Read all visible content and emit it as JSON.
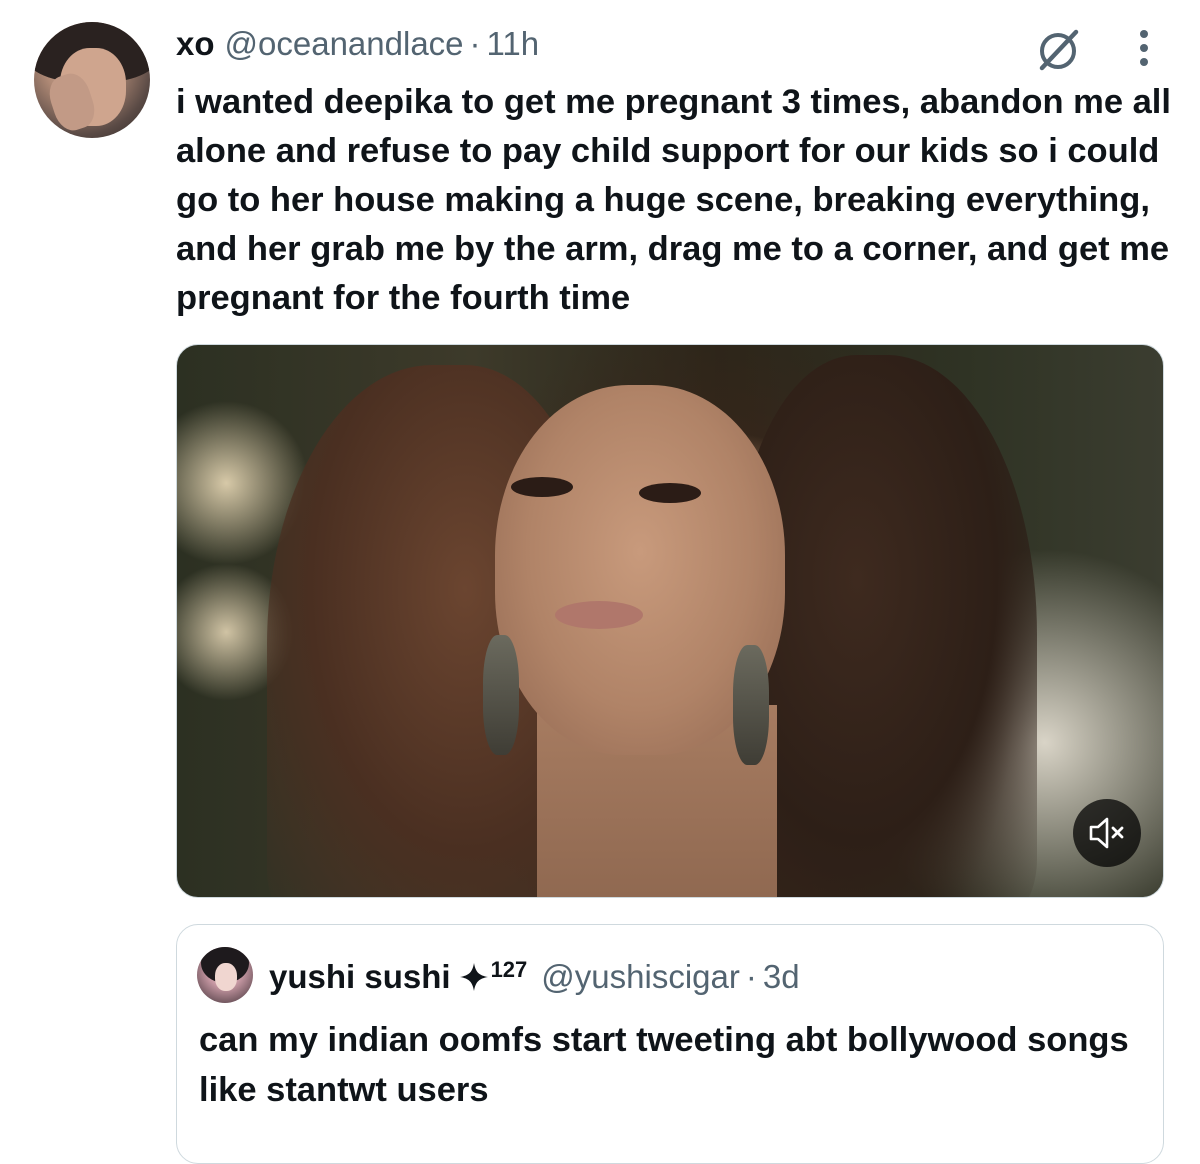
{
  "tweet": {
    "author_name": "xo",
    "author_handle": "@oceanandlace",
    "separator": "·",
    "time": "11h",
    "text": "i wanted deepika to get me pregnant 3 times, abandon me all alone and refuse to pay child support for our kids so i could go to her house making a huge scene, breaking everything, and her grab me by the arm, drag me to a corner, and get me pregnant for the fourth time",
    "grok_icon": "grok-icon",
    "more_icon": "more-options-icon",
    "media": {
      "type": "video",
      "mute_icon": "volume-muted-icon"
    }
  },
  "quoted_tweet": {
    "author_name": "yushi sushi",
    "badge_icon": "sparkle-icon",
    "badge_count": "127",
    "author_handle": "@yushiscigar",
    "separator": "·",
    "time": "3d",
    "text": "can my indian oomfs start tweeting abt bollywood songs like stantwt users"
  },
  "colors": {
    "primary_text": "#0f1419",
    "secondary_text": "#536471",
    "border": "#cfd9de"
  }
}
